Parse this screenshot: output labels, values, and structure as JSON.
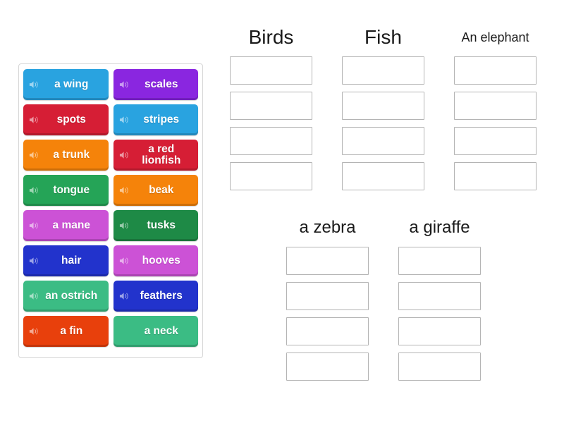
{
  "activity": {
    "type": "group-sort",
    "tiles_panel_name": "word-tiles-panel"
  },
  "tiles": [
    {
      "label": "a wing",
      "color": "#29A3E0",
      "has_audio": true,
      "icon": "speaker-icon"
    },
    {
      "label": "scales",
      "color": "#8A26E0",
      "has_audio": true,
      "icon": "speaker-icon"
    },
    {
      "label": "spots",
      "color": "#D61E35",
      "has_audio": true,
      "icon": "speaker-icon"
    },
    {
      "label": "stripes",
      "color": "#29A3E0",
      "has_audio": true,
      "icon": "speaker-icon"
    },
    {
      "label": "a trunk",
      "color": "#F5830A",
      "has_audio": true,
      "icon": "speaker-icon"
    },
    {
      "label": "a red lionfish",
      "color": "#D61E35",
      "has_audio": true,
      "icon": "speaker-icon"
    },
    {
      "label": "tongue",
      "color": "#25A457",
      "has_audio": true,
      "icon": "speaker-icon"
    },
    {
      "label": "beak",
      "color": "#F5830A",
      "has_audio": true,
      "icon": "speaker-icon"
    },
    {
      "label": "a mane",
      "color": "#CC52D6",
      "has_audio": true,
      "icon": "speaker-icon"
    },
    {
      "label": "tusks",
      "color": "#1E8A46",
      "has_audio": true,
      "icon": "speaker-icon"
    },
    {
      "label": "hair",
      "color": "#2233CC",
      "has_audio": true,
      "icon": "speaker-icon"
    },
    {
      "label": "hooves",
      "color": "#CC52D6",
      "has_audio": true,
      "icon": "speaker-icon"
    },
    {
      "label": "an ostrich",
      "color": "#3BBC84",
      "has_audio": true,
      "icon": "speaker-icon"
    },
    {
      "label": "feathers",
      "color": "#2233CC",
      "has_audio": true,
      "icon": "speaker-icon"
    },
    {
      "label": "a fin",
      "color": "#E8400C",
      "has_audio": true,
      "icon": "speaker-icon"
    },
    {
      "label": "a neck",
      "color": "#3BBC84",
      "has_audio": false,
      "icon": ""
    }
  ],
  "category_groups": [
    {
      "name": "top-row",
      "columns": [
        {
          "title": "Birds",
          "title_size": "size-lg",
          "slots": 4
        },
        {
          "title": "Fish",
          "title_size": "size-lg",
          "slots": 4
        },
        {
          "title": "An elephant",
          "title_size": "size-sm",
          "slots": 4
        }
      ]
    },
    {
      "name": "bottom-row",
      "columns": [
        {
          "title": "a zebra",
          "title_size": "size-md",
          "slots": 4
        },
        {
          "title": "a giraffe",
          "title_size": "size-md",
          "slots": 4
        }
      ]
    }
  ],
  "colors": {
    "page_background": "#ffffff",
    "panel_border": "#d6d6d6",
    "dropzone_border": "#b4b4b4",
    "title_text": "#1a1a1a",
    "tile_text": "#ffffff"
  }
}
